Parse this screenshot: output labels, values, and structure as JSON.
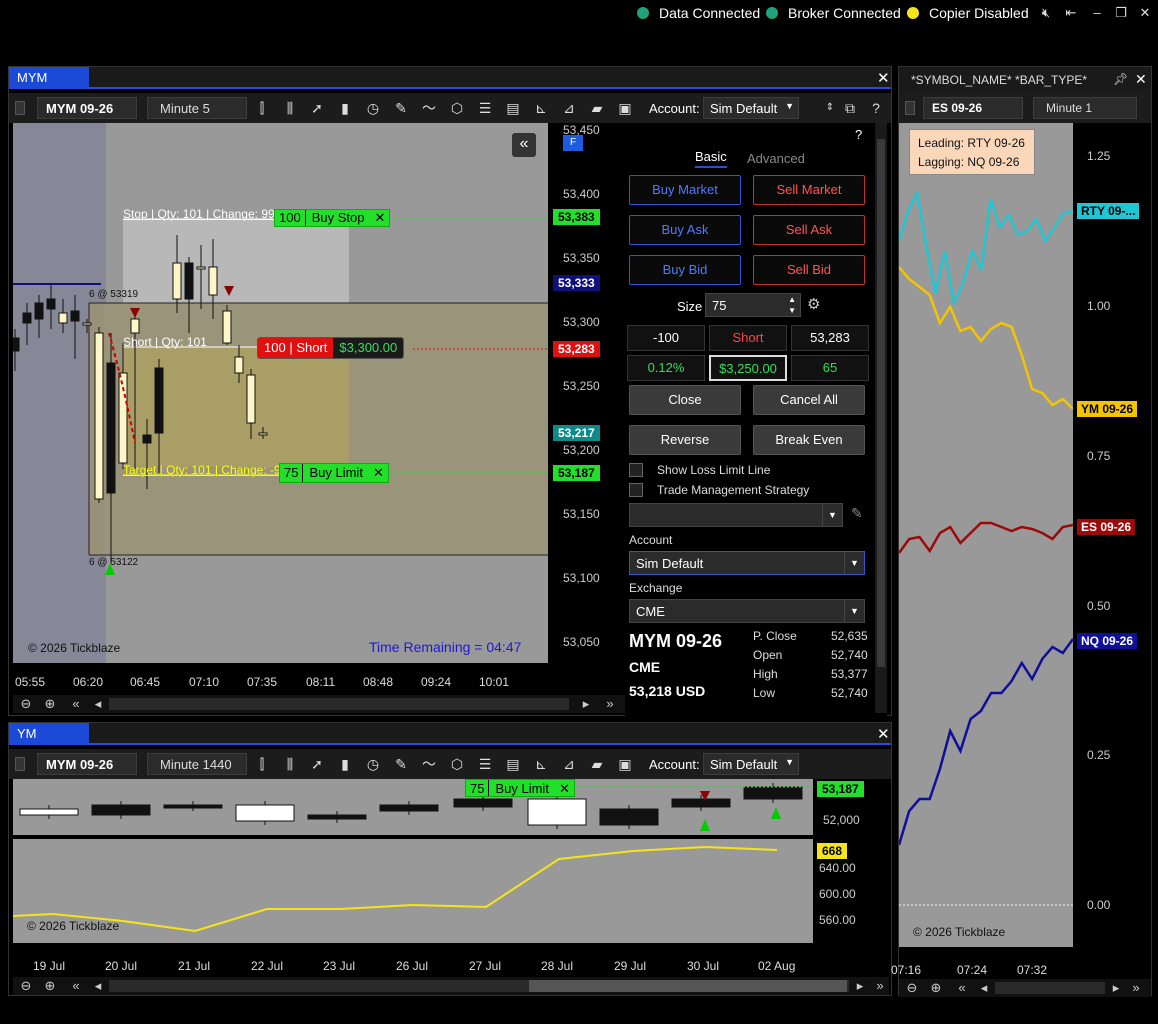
{
  "status": {
    "items": [
      {
        "label": "Data Connected",
        "color": "#1fa37a"
      },
      {
        "label": "Broker Connected",
        "color": "#1fa37a"
      },
      {
        "label": "Copier Disabled",
        "color": "#f5e31b"
      }
    ]
  },
  "main": {
    "tab": "MYM",
    "symbol": "MYM 09-26",
    "timeframe": "Minute 5",
    "account_label": "Account:",
    "account": "Sim Default",
    "price_axis": [
      "53,450",
      "53,400",
      "53,350",
      "53,300",
      "53,250",
      "53,200",
      "53,150",
      "53,100",
      "53,050"
    ],
    "price_tags": [
      {
        "text": "53,383",
        "bg": "#22e02a"
      },
      {
        "text": "53,333",
        "bg": "#10107a",
        "fg": "#fff"
      },
      {
        "text": "53,283",
        "bg": "#e01010",
        "fg": "#fff"
      },
      {
        "text": "53,217",
        "bg": "#0f8a8a",
        "fg": "#fff"
      },
      {
        "text": "53,187",
        "bg": "#22e02a"
      }
    ],
    "time_axis": [
      "05:55",
      "06:20",
      "06:45",
      "07:10",
      "07:35",
      "08:11",
      "08:48",
      "09:24",
      "10:01"
    ],
    "copyright": "© 2026 Tickblaze",
    "time_remaining": "Time Remaining = 04:47",
    "f_badge": "F",
    "stop_label": "Stop | Qty: 101 | Change: 99",
    "stop_order": {
      "qty": "100",
      "label": "Buy Stop"
    },
    "short_label": "Short | Qty: 101",
    "short_order": {
      "qty": "100",
      "label": "Short",
      "pnl": "$3,300.00"
    },
    "target_label": "Target | Qty: 101 | Change: -9",
    "target_order": {
      "qty": "75",
      "label": "Buy Limit"
    },
    "marker_top": "6 @ 53319",
    "marker_bottom": "6 @ 53122"
  },
  "order": {
    "tabs": [
      "Basic",
      "Advanced"
    ],
    "buy_market": "Buy Market",
    "sell_market": "Sell Market",
    "buy_ask": "Buy Ask",
    "sell_ask": "Sell Ask",
    "buy_bid": "Buy Bid",
    "sell_bid": "Sell Bid",
    "size_label": "Size",
    "size": "75",
    "pos": "-100",
    "side": "Short",
    "avg": "53,283",
    "pct": "0.12%",
    "pnl": "$3,250.00",
    "ticks": "65",
    "close": "Close",
    "cancel_all": "Cancel All",
    "reverse": "Reverse",
    "break_even": "Break Even",
    "show_loss": "Show Loss Limit Line",
    "tms": "Trade Management Strategy",
    "account_label": "Account",
    "account": "Sim Default",
    "exchange_label": "Exchange",
    "exchange": "CME",
    "quote_symbol": "MYM 09-26",
    "quote_exchange": "CME",
    "quote_last": "53,218 USD",
    "quotes": [
      {
        "k": "P. Close",
        "v": "52,635"
      },
      {
        "k": "Open",
        "v": "52,740"
      },
      {
        "k": "High",
        "v": "53,377"
      },
      {
        "k": "Low",
        "v": "52,740"
      }
    ]
  },
  "bottom": {
    "tab": "YM",
    "symbol": "MYM 09-26",
    "timeframe": "Minute 1440",
    "account_label": "Account:",
    "account": "Sim Default",
    "price_axis": [
      "52,000"
    ],
    "price_tag": "53,187",
    "ind_axis": [
      "640.00",
      "600.00",
      "560.00"
    ],
    "ind_tag": "668",
    "time_axis": [
      "19 Jul",
      "20 Jul",
      "21 Jul",
      "22 Jul",
      "23 Jul",
      "26 Jul",
      "27 Jul",
      "28 Jul",
      "29 Jul",
      "30 Jul",
      "02 Aug"
    ],
    "order_qty": "75",
    "order_label": "Buy Limit",
    "copyright": "© 2026 Tickblaze",
    "ind_values": [
      600,
      598,
      590,
      580,
      570,
      565,
      566,
      575,
      610,
      660,
      672,
      678,
      675,
      670,
      666,
      668
    ]
  },
  "side": {
    "title": "*SYMBOL_NAME* *BAR_TYPE*",
    "symbol": "ES 09-26",
    "timeframe": "Minute 1",
    "leading": "Leading: RTY 09-26",
    "lagging": "Lagging: NQ 09-26",
    "axis": [
      "1.25",
      "1.00",
      "0.75",
      "0.50",
      "0.25",
      "0.00"
    ],
    "series": [
      {
        "name": "RTY 09-...",
        "color": "#1fc6d4"
      },
      {
        "name": "YM 09-26",
        "color": "#f5c400"
      },
      {
        "name": "ES 09-26",
        "color": "#9a0a0a"
      },
      {
        "name": "NQ 09-26",
        "color": "#0f0f9a"
      }
    ],
    "time_axis": [
      "07:16",
      "07:24",
      "07:32"
    ],
    "copyright": "© 2026 Tickblaze"
  }
}
